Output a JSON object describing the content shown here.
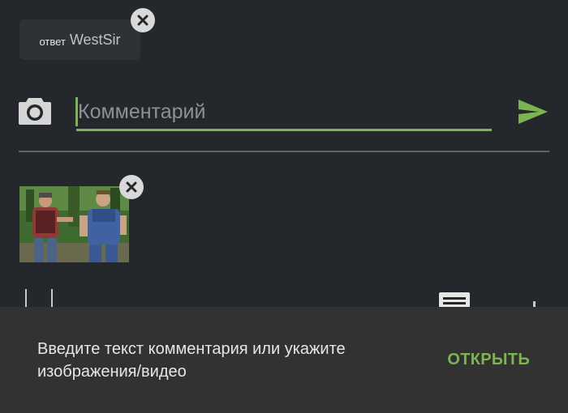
{
  "reply": {
    "prefix": "ответ",
    "username": "WestSir"
  },
  "composer": {
    "placeholder": "Комментарий",
    "value": ""
  },
  "icons": {
    "camera": "camera-icon",
    "send": "send-icon",
    "remove": "close-icon",
    "document": "document-icon"
  },
  "colors": {
    "accent": "#7bb54f",
    "background": "#24272b",
    "snackbar": "#323232"
  },
  "snackbar": {
    "message": "Введите текст комментария или укажите изображения/видео",
    "action": "ОТКРЫТЬ"
  }
}
